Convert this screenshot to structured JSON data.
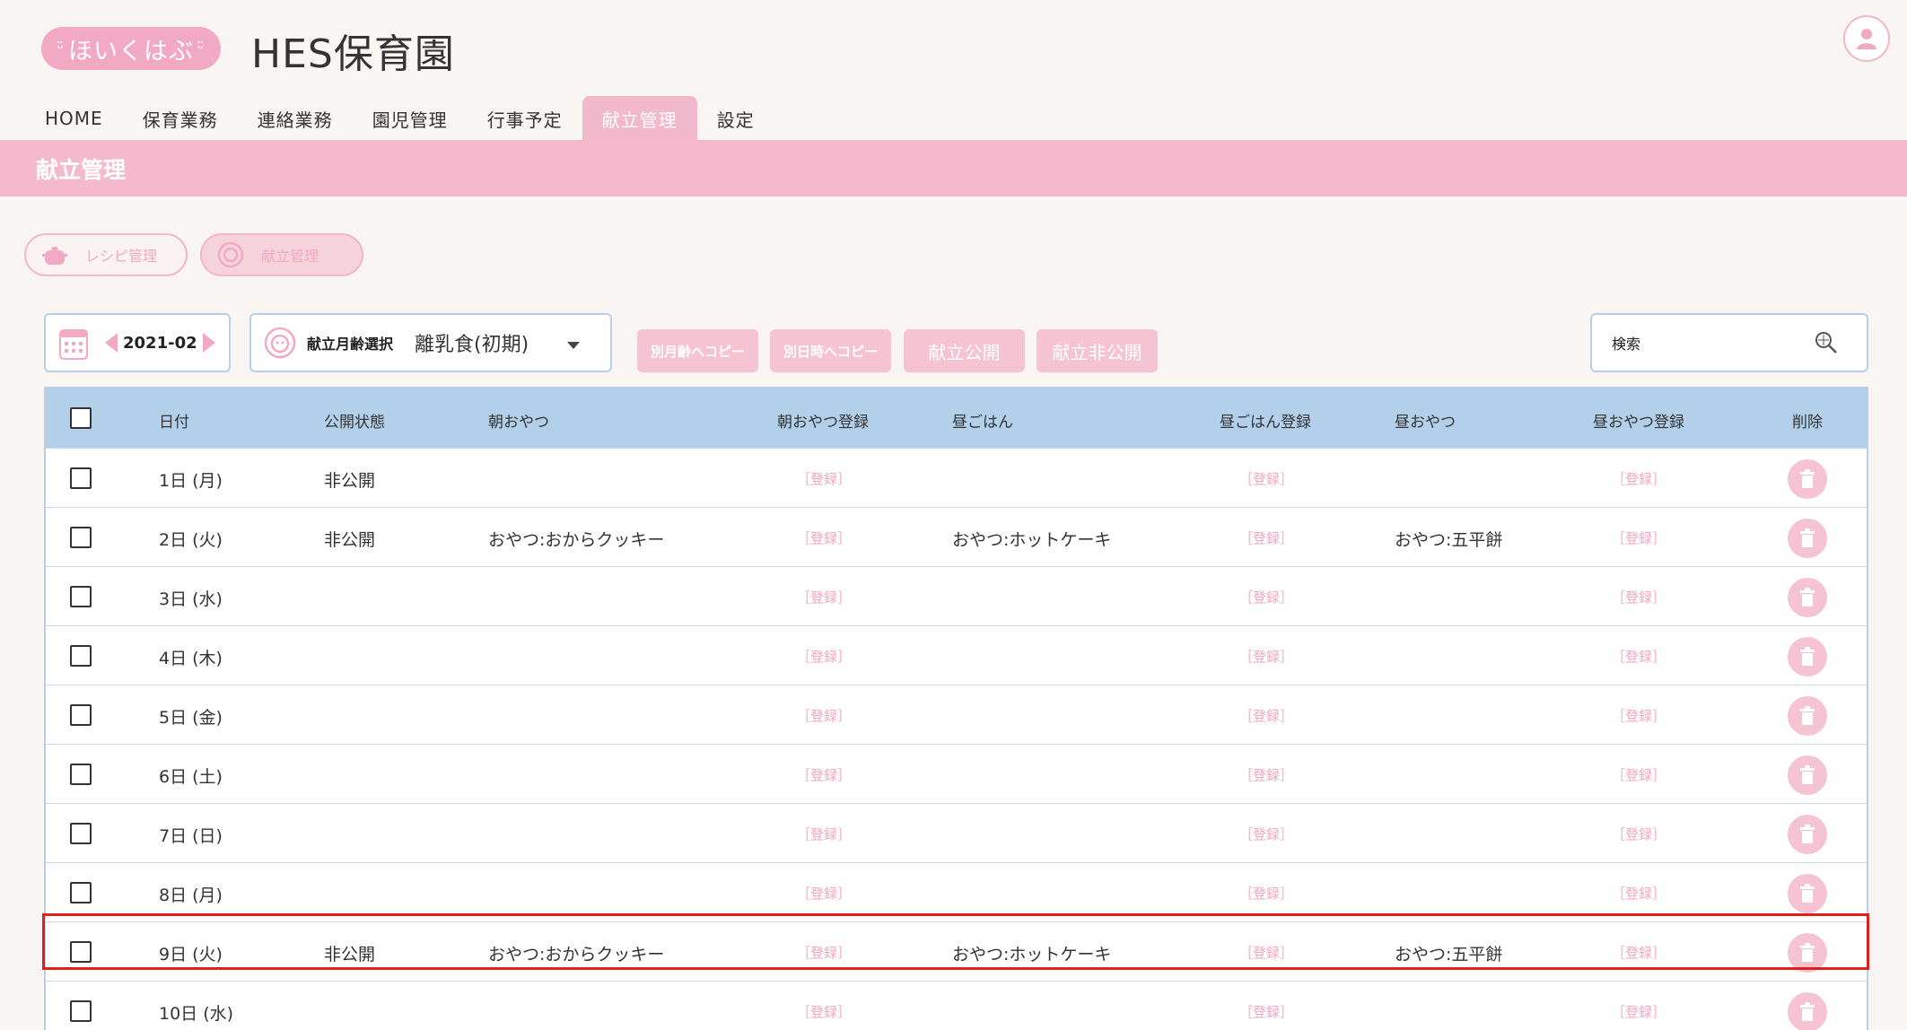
{
  "header": {
    "logo_text": "ほいくはぶ",
    "app_title": "HES保育園",
    "avatar_icon": "user-icon"
  },
  "nav": {
    "items": [
      {
        "label": "HOME",
        "active": false
      },
      {
        "label": "保育業務",
        "active": false
      },
      {
        "label": "連絡業務",
        "active": false
      },
      {
        "label": "園児管理",
        "active": false
      },
      {
        "label": "行事予定",
        "active": false
      },
      {
        "label": "献立管理",
        "active": true
      },
      {
        "label": "設定",
        "active": false
      }
    ]
  },
  "page_title": "献立管理",
  "subtabs": [
    {
      "label": "レシピ管理",
      "icon": "pot-icon"
    },
    {
      "label": "献立管理",
      "icon": "meal-icon"
    }
  ],
  "controls": {
    "month": "2021-02",
    "age_label": "献立月齢選択",
    "age_value": "離乳食(初期)",
    "buttons": [
      "別月齢へコピー",
      "別日時へコピー",
      "献立公開",
      "献立非公開"
    ],
    "search_placeholder": "検索"
  },
  "table": {
    "columns": [
      "日付",
      "公開状態",
      "朝おやつ",
      "朝おやつ登録",
      "昼ごはん",
      "昼ごはん登録",
      "昼おやつ",
      "昼おやつ登録",
      "削除"
    ],
    "register_label": "［登録］",
    "rows": [
      {
        "date": "1日 (月)",
        "status": "非公開",
        "morning_snack": "",
        "lunch": "",
        "afternoon_snack": ""
      },
      {
        "date": "2日 (火)",
        "status": "非公開",
        "morning_snack": "おやつ:おからクッキー",
        "lunch": "おやつ:ホットケーキ",
        "afternoon_snack": "おやつ:五平餅"
      },
      {
        "date": "3日 (水)",
        "status": "",
        "morning_snack": "",
        "lunch": "",
        "afternoon_snack": ""
      },
      {
        "date": "4日 (木)",
        "status": "",
        "morning_snack": "",
        "lunch": "",
        "afternoon_snack": ""
      },
      {
        "date": "5日 (金)",
        "status": "",
        "morning_snack": "",
        "lunch": "",
        "afternoon_snack": ""
      },
      {
        "date": "6日 (土)",
        "status": "",
        "morning_snack": "",
        "lunch": "",
        "afternoon_snack": ""
      },
      {
        "date": "7日 (日)",
        "status": "",
        "morning_snack": "",
        "lunch": "",
        "afternoon_snack": ""
      },
      {
        "date": "8日 (月)",
        "status": "",
        "morning_snack": "",
        "lunch": "",
        "afternoon_snack": ""
      },
      {
        "date": "9日 (火)",
        "status": "非公開",
        "morning_snack": "おやつ:おからクッキー",
        "lunch": "おやつ:ホットケーキ",
        "afternoon_snack": "おやつ:五平餅"
      },
      {
        "date": "10日 (水)",
        "status": "",
        "morning_snack": "",
        "lunch": "",
        "afternoon_snack": ""
      }
    ]
  },
  "colors": {
    "accent_pink": "#f4b9cc",
    "header_blue": "#b3d0ea",
    "highlight_red": "#e02020"
  }
}
